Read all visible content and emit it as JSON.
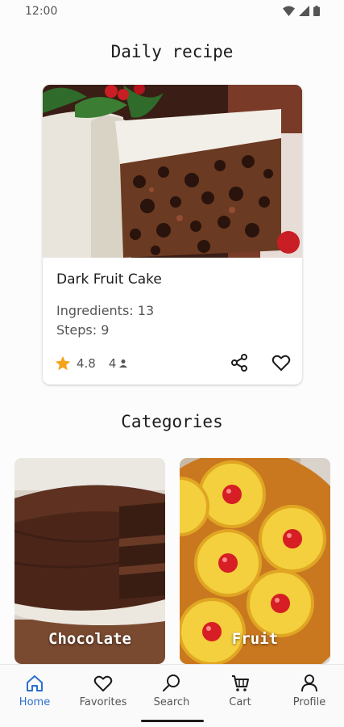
{
  "status_bar": {
    "time": "12:00"
  },
  "daily": {
    "heading": "Daily recipe",
    "recipe": {
      "name": "Dark Fruit Cake",
      "ingredients": "Ingredients: 13",
      "steps": "Steps: 9",
      "rating": "4.8",
      "servings": "4"
    }
  },
  "categories": {
    "heading": "Categories",
    "items": [
      {
        "label": "Chocolate"
      },
      {
        "label": "Fruit"
      }
    ]
  },
  "nav": {
    "items": [
      {
        "label": "Home",
        "icon": "home-icon"
      },
      {
        "label": "Favorites",
        "icon": "heart-icon"
      },
      {
        "label": "Search",
        "icon": "search-icon"
      },
      {
        "label": "Cart",
        "icon": "cart-icon"
      },
      {
        "label": "Profile",
        "icon": "profile-icon"
      }
    ],
    "active": "Home"
  },
  "colors": {
    "accent": "#2c6fd1",
    "star": "#f4a31b"
  }
}
